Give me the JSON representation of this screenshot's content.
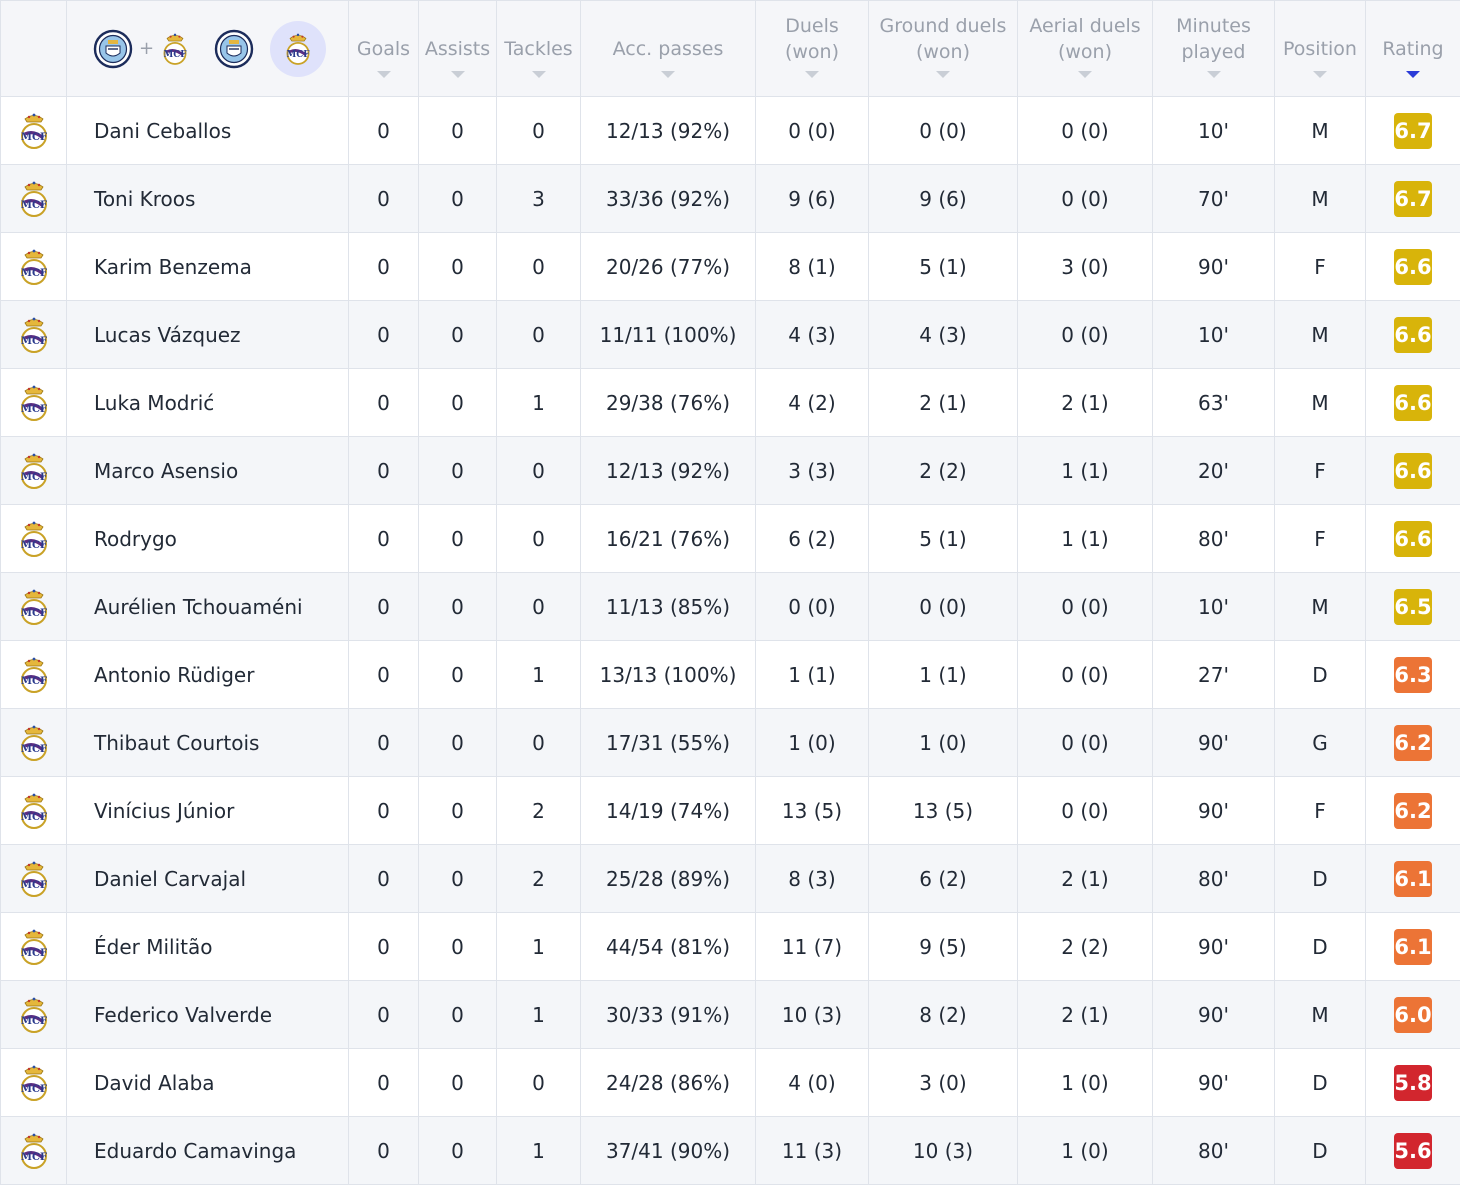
{
  "colors": {
    "rating_high": "#d8b40a",
    "rating_mid": "#ec7436",
    "rating_low": "#d2262e",
    "active_team_bg": "#dfe2fb",
    "sort_active": "#2a3bd8"
  },
  "team_switcher": {
    "combined_icons": [
      "man-city-crest-icon",
      "real-madrid-crest-icon"
    ],
    "plus": "+",
    "home_icon": "man-city-crest-icon",
    "away_icon": "real-madrid-crest-icon",
    "active": "away"
  },
  "columns": {
    "goals": "Goals",
    "assists": "Assists",
    "tackles": "Tackles",
    "acc_passes": "Acc. passes",
    "duels": "Duels (won)",
    "ground_duels": "Ground duels (won)",
    "aerial_duels": "Aerial duels (won)",
    "minutes": "Minutes played",
    "position": "Position",
    "rating": "Rating"
  },
  "sorted_by": "rating",
  "players": [
    {
      "name": "Dani Ceballos",
      "goals": "0",
      "assists": "0",
      "tackles": "0",
      "acc_passes": "12/13 (92%)",
      "duels": "0 (0)",
      "ground_duels": "0 (0)",
      "aerial_duels": "0 (0)",
      "minutes": "10'",
      "position": "M",
      "rating": "6.7",
      "rating_level": "high"
    },
    {
      "name": "Toni Kroos",
      "goals": "0",
      "assists": "0",
      "tackles": "3",
      "acc_passes": "33/36 (92%)",
      "duels": "9 (6)",
      "ground_duels": "9 (6)",
      "aerial_duels": "0 (0)",
      "minutes": "70'",
      "position": "M",
      "rating": "6.7",
      "rating_level": "high"
    },
    {
      "name": "Karim Benzema",
      "goals": "0",
      "assists": "0",
      "tackles": "0",
      "acc_passes": "20/26 (77%)",
      "duels": "8 (1)",
      "ground_duels": "5 (1)",
      "aerial_duels": "3 (0)",
      "minutes": "90'",
      "position": "F",
      "rating": "6.6",
      "rating_level": "high"
    },
    {
      "name": "Lucas Vázquez",
      "goals": "0",
      "assists": "0",
      "tackles": "0",
      "acc_passes": "11/11 (100%)",
      "duels": "4 (3)",
      "ground_duels": "4 (3)",
      "aerial_duels": "0 (0)",
      "minutes": "10'",
      "position": "M",
      "rating": "6.6",
      "rating_level": "high"
    },
    {
      "name": "Luka Modrić",
      "goals": "0",
      "assists": "0",
      "tackles": "1",
      "acc_passes": "29/38 (76%)",
      "duels": "4 (2)",
      "ground_duels": "2 (1)",
      "aerial_duels": "2 (1)",
      "minutes": "63'",
      "position": "M",
      "rating": "6.6",
      "rating_level": "high"
    },
    {
      "name": "Marco Asensio",
      "goals": "0",
      "assists": "0",
      "tackles": "0",
      "acc_passes": "12/13 (92%)",
      "duels": "3 (3)",
      "ground_duels": "2 (2)",
      "aerial_duels": "1 (1)",
      "minutes": "20'",
      "position": "F",
      "rating": "6.6",
      "rating_level": "high"
    },
    {
      "name": "Rodrygo",
      "goals": "0",
      "assists": "0",
      "tackles": "0",
      "acc_passes": "16/21 (76%)",
      "duels": "6 (2)",
      "ground_duels": "5 (1)",
      "aerial_duels": "1 (1)",
      "minutes": "80'",
      "position": "F",
      "rating": "6.6",
      "rating_level": "high"
    },
    {
      "name": "Aurélien Tchouaméni",
      "goals": "0",
      "assists": "0",
      "tackles": "0",
      "acc_passes": "11/13 (85%)",
      "duels": "0 (0)",
      "ground_duels": "0 (0)",
      "aerial_duels": "0 (0)",
      "minutes": "10'",
      "position": "M",
      "rating": "6.5",
      "rating_level": "high"
    },
    {
      "name": "Antonio Rüdiger",
      "goals": "0",
      "assists": "0",
      "tackles": "1",
      "acc_passes": "13/13 (100%)",
      "duels": "1 (1)",
      "ground_duels": "1 (1)",
      "aerial_duels": "0 (0)",
      "minutes": "27'",
      "position": "D",
      "rating": "6.3",
      "rating_level": "mid"
    },
    {
      "name": "Thibaut Courtois",
      "goals": "0",
      "assists": "0",
      "tackles": "0",
      "acc_passes": "17/31 (55%)",
      "duels": "1 (0)",
      "ground_duels": "1 (0)",
      "aerial_duels": "0 (0)",
      "minutes": "90'",
      "position": "G",
      "rating": "6.2",
      "rating_level": "mid"
    },
    {
      "name": "Vinícius Júnior",
      "goals": "0",
      "assists": "0",
      "tackles": "2",
      "acc_passes": "14/19 (74%)",
      "duels": "13 (5)",
      "ground_duels": "13 (5)",
      "aerial_duels": "0 (0)",
      "minutes": "90'",
      "position": "F",
      "rating": "6.2",
      "rating_level": "mid"
    },
    {
      "name": "Daniel Carvajal",
      "goals": "0",
      "assists": "0",
      "tackles": "2",
      "acc_passes": "25/28 (89%)",
      "duels": "8 (3)",
      "ground_duels": "6 (2)",
      "aerial_duels": "2 (1)",
      "minutes": "80'",
      "position": "D",
      "rating": "6.1",
      "rating_level": "mid"
    },
    {
      "name": "Éder Militão",
      "goals": "0",
      "assists": "0",
      "tackles": "1",
      "acc_passes": "44/54 (81%)",
      "duels": "11 (7)",
      "ground_duels": "9 (5)",
      "aerial_duels": "2 (2)",
      "minutes": "90'",
      "position": "D",
      "rating": "6.1",
      "rating_level": "mid"
    },
    {
      "name": "Federico Valverde",
      "goals": "0",
      "assists": "0",
      "tackles": "1",
      "acc_passes": "30/33 (91%)",
      "duels": "10 (3)",
      "ground_duels": "8 (2)",
      "aerial_duels": "2 (1)",
      "minutes": "90'",
      "position": "M",
      "rating": "6.0",
      "rating_level": "mid"
    },
    {
      "name": "David Alaba",
      "goals": "0",
      "assists": "0",
      "tackles": "0",
      "acc_passes": "24/28 (86%)",
      "duels": "4 (0)",
      "ground_duels": "3 (0)",
      "aerial_duels": "1 (0)",
      "minutes": "90'",
      "position": "D",
      "rating": "5.8",
      "rating_level": "low"
    },
    {
      "name": "Eduardo Camavinga",
      "goals": "0",
      "assists": "0",
      "tackles": "1",
      "acc_passes": "37/41 (90%)",
      "duels": "11 (3)",
      "ground_duels": "10 (3)",
      "aerial_duels": "1 (0)",
      "minutes": "80'",
      "position": "D",
      "rating": "5.6",
      "rating_level": "low"
    }
  ]
}
